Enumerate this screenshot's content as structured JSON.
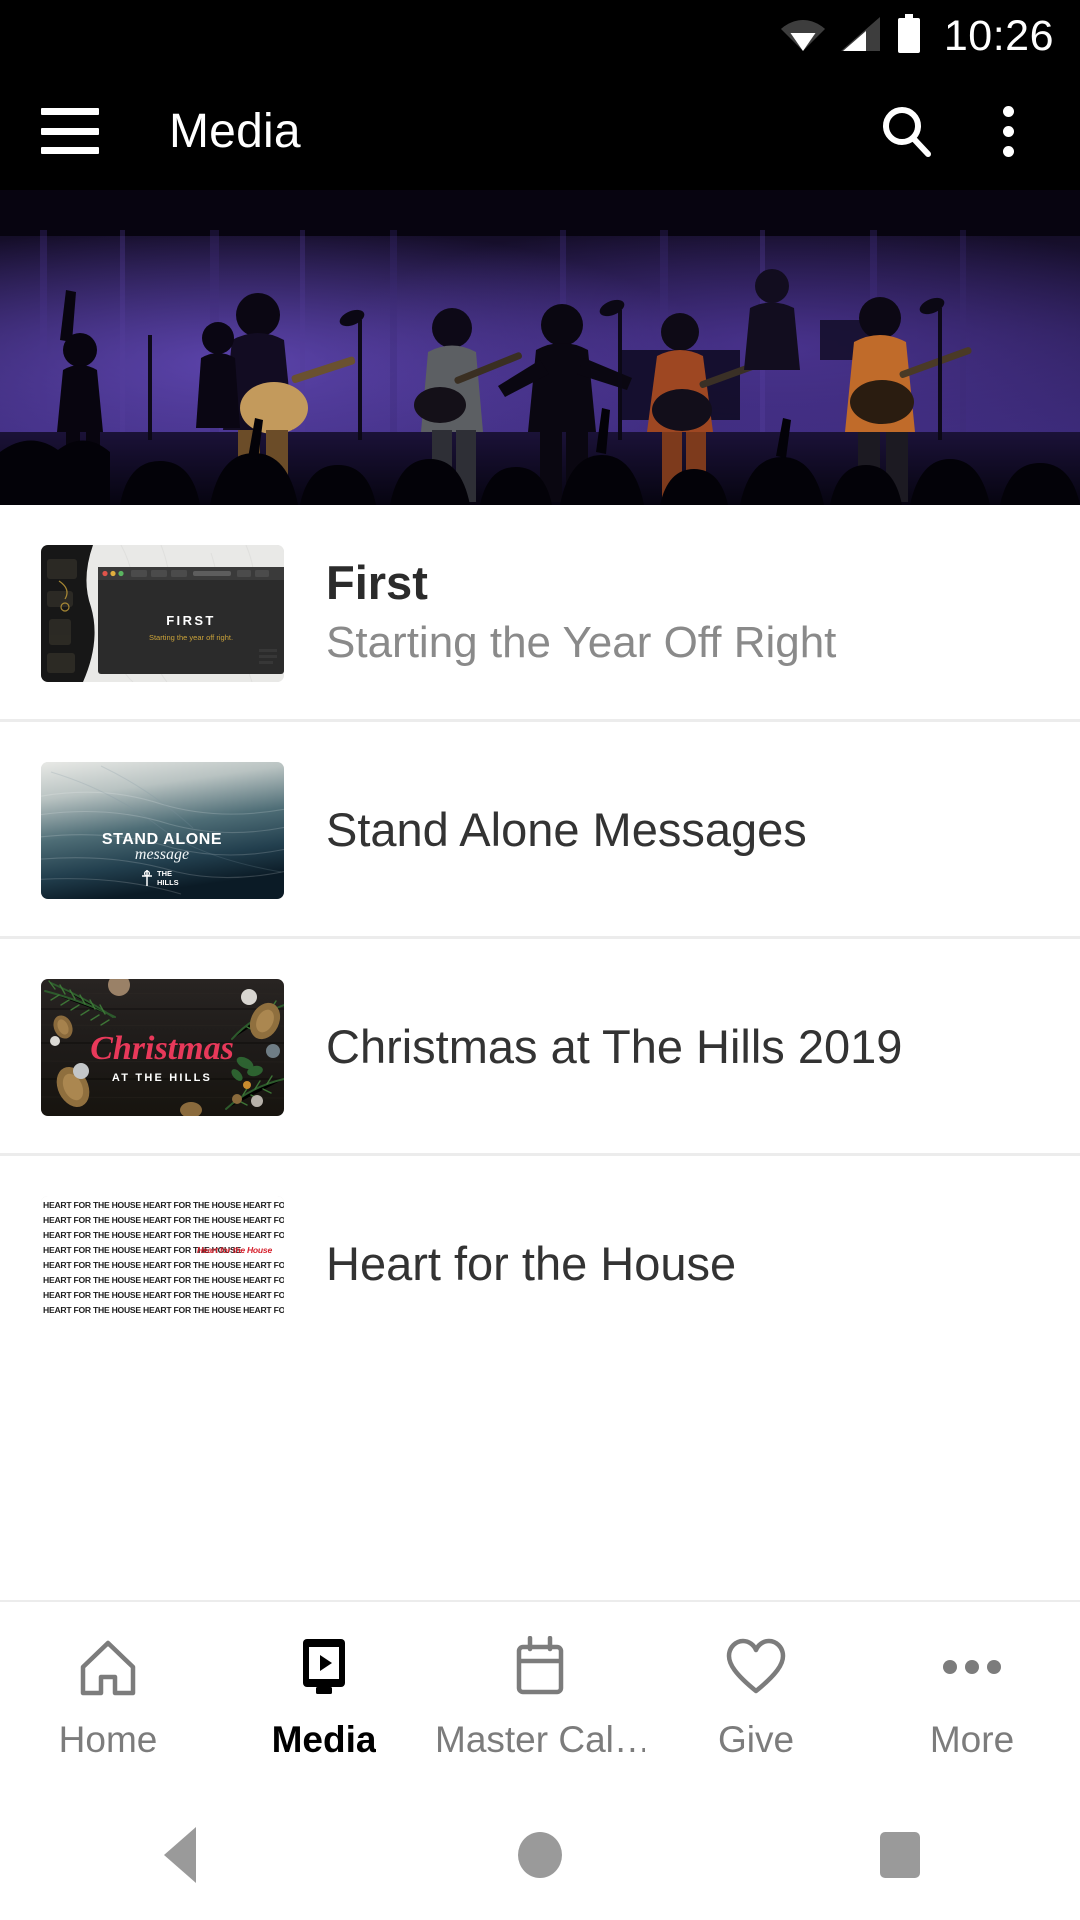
{
  "status_bar": {
    "time": "10:26",
    "icons": [
      "wifi-icon",
      "cellular-signal-icon",
      "battery-icon"
    ]
  },
  "app_bar": {
    "menu_icon": "hamburger-menu-icon",
    "title": "Media",
    "search_icon": "search-icon",
    "overflow_icon": "overflow-menu-icon"
  },
  "hero": {
    "alt": "worship band performing on a purple-lit stage"
  },
  "media_list": {
    "items": [
      {
        "title": "First",
        "subtitle": "Starting the Year Off Right",
        "thumb_kind": "laptop-browser-mockup",
        "thumb_text_main": "FIRST",
        "thumb_text_sub": "Starting the year off right."
      },
      {
        "title": "Stand Alone Messages",
        "subtitle": "",
        "thumb_kind": "ocean-gradient",
        "thumb_text_main": "STAND ALONE",
        "thumb_text_sub": "message",
        "thumb_logo": "THE HILLS"
      },
      {
        "title": "Christmas at The Hills 2019",
        "subtitle": "",
        "thumb_kind": "christmas-wood",
        "thumb_text_main": "Christmas",
        "thumb_text_sub": "AT THE HILLS"
      },
      {
        "title": "Heart for the House",
        "subtitle": "",
        "thumb_kind": "repeating-type",
        "thumb_text_main": "HEART FOR THE HOUSE",
        "thumb_text_accent": "Heart for the House"
      }
    ]
  },
  "bottom_nav": {
    "items": [
      {
        "label": "Home",
        "icon": "home-icon",
        "active": false
      },
      {
        "label": "Media",
        "icon": "media-icon",
        "active": true
      },
      {
        "label": "Master Cal…",
        "icon": "calendar-icon",
        "active": false
      },
      {
        "label": "Give",
        "icon": "heart-icon",
        "active": false
      },
      {
        "label": "More",
        "icon": "more-dots-icon",
        "active": false
      }
    ]
  },
  "android_nav": {
    "back": "back-icon",
    "home": "home-circle-icon",
    "recents": "recents-icon"
  },
  "colors": {
    "app_bar_bg": "#000000",
    "page_bg": "#ffffff",
    "title_text": "#333333",
    "subtitle_text": "#8a8a8a",
    "divider": "#ececec",
    "nav_inactive": "#7c7c7c",
    "nav_active": "#000000",
    "christmas_red": "#e8395a"
  }
}
